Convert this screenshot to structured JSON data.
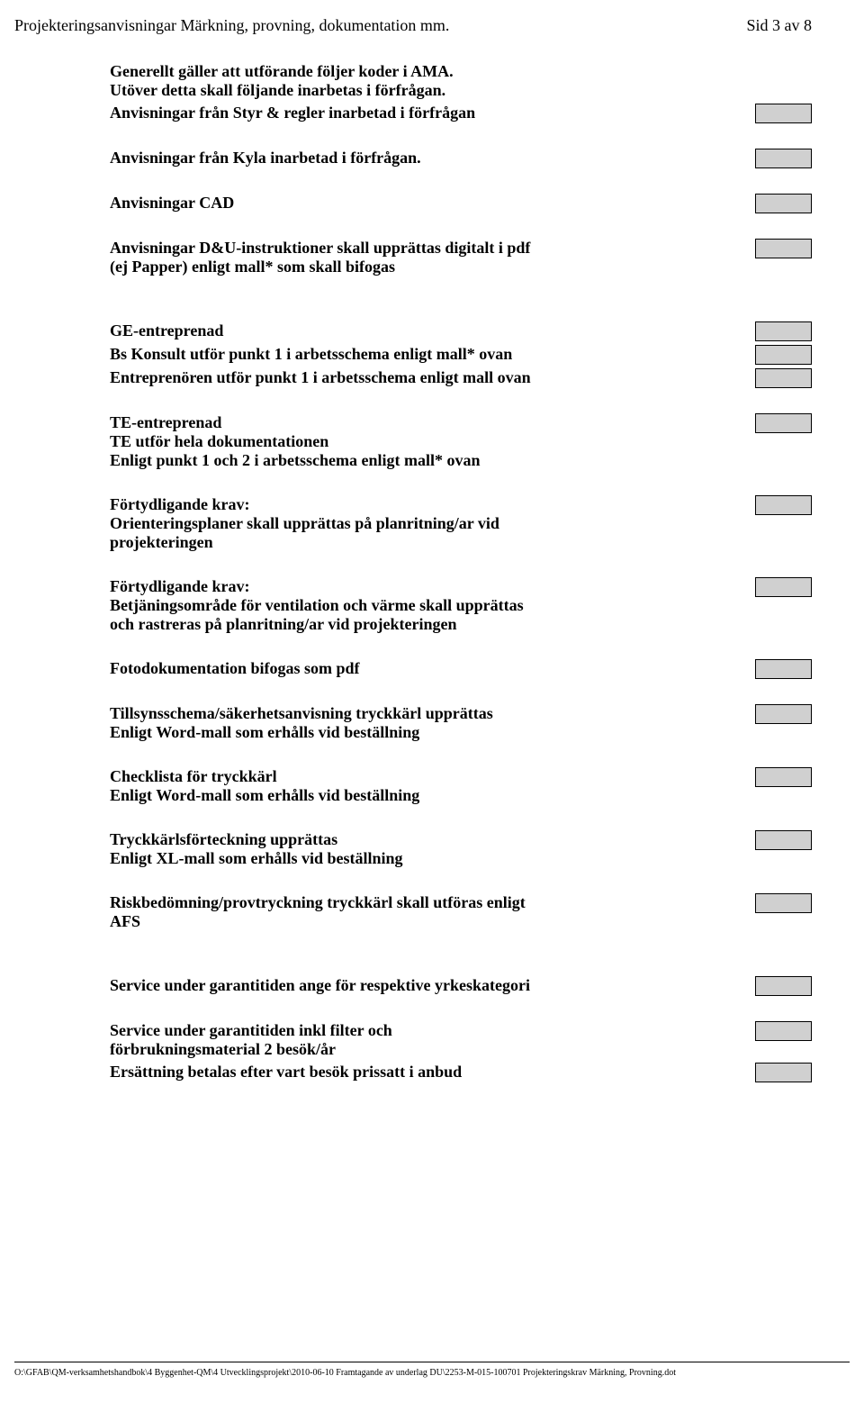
{
  "header": {
    "title": "Projekteringsanvisningar Märkning, provning, dokumentation mm.",
    "page": "Sid 3 av 8"
  },
  "intro": {
    "line1": "Generellt gäller att utförande följer koder i AMA.",
    "line2": "Utöver detta skall följande inarbetas i förfrågan."
  },
  "items": {
    "anv_styr": "Anvisningar från Styr & regler inarbetad i förfrågan",
    "anv_kyla": "Anvisningar från Kyla inarbetad i förfrågan.",
    "anv_cad": "Anvisningar CAD",
    "anv_du_l1": "Anvisningar D&U-instruktioner skall upprättas digitalt i pdf",
    "anv_du_l2": "(ej Papper) enligt mall* som skall bifogas",
    "ge_entr": "GE-entreprenad",
    "bs_konsult": "Bs Konsult utför punkt 1 i arbetsschema enligt mall* ovan",
    "entrepren": "Entreprenören utför punkt 1 i arbetsschema enligt mall ovan",
    "te_entr": "TE-entreprenad",
    "te_utfor": "TE utför hela dokumentationen",
    "te_enligt": "Enligt punkt 1 och 2 i arbetsschema enligt mall* ovan",
    "fortydl1_head": "Förtydligande krav:",
    "fortydl1_l1": "Orienteringsplaner skall upprättas på planritning/ar vid",
    "fortydl1_l2": "projekteringen",
    "fortydl2_head": "Förtydligande krav:",
    "fortydl2_l1": "Betjäningsområde för ventilation och värme skall upprättas",
    "fortydl2_l2": "och rastreras på planritning/ar vid projekteringen",
    "fotodok": "Fotodokumentation bifogas som pdf",
    "tillsyn_l1": "Tillsynsschema/säkerhetsanvisning tryckkärl upprättas",
    "tillsyn_l2": "Enligt Word-mall som erhålls vid beställning",
    "checklista_l1": "Checklista för tryckkärl",
    "checklista_l2": "Enligt Word-mall som erhålls vid beställning",
    "tryckkarl_l1": "Tryckkärlsförteckning upprättas",
    "tryckkarl_l2": "Enligt XL-mall som erhålls vid beställning",
    "riskbed_l1": "Riskbedömning/provtryckning tryckkärl skall utföras enligt",
    "riskbed_l2": "AFS",
    "service_gar": "Service under garantitiden ange för respektive yrkeskategori",
    "service_filter_l1": "Service under garantitiden inkl filter och",
    "service_filter_l2": "förbrukningsmaterial 2 besök/år",
    "ersattning": "Ersättning betalas efter vart besök prissatt i anbud"
  },
  "footer": "O:\\GFAB\\QM-verksamhetshandbok\\4 Byggenhet-QM\\4 Utvecklingsprojekt\\2010-06-10 Framtagande av underlag DU\\2253-M-015-100701 Projekteringskrav Märkning, Provning.dot"
}
